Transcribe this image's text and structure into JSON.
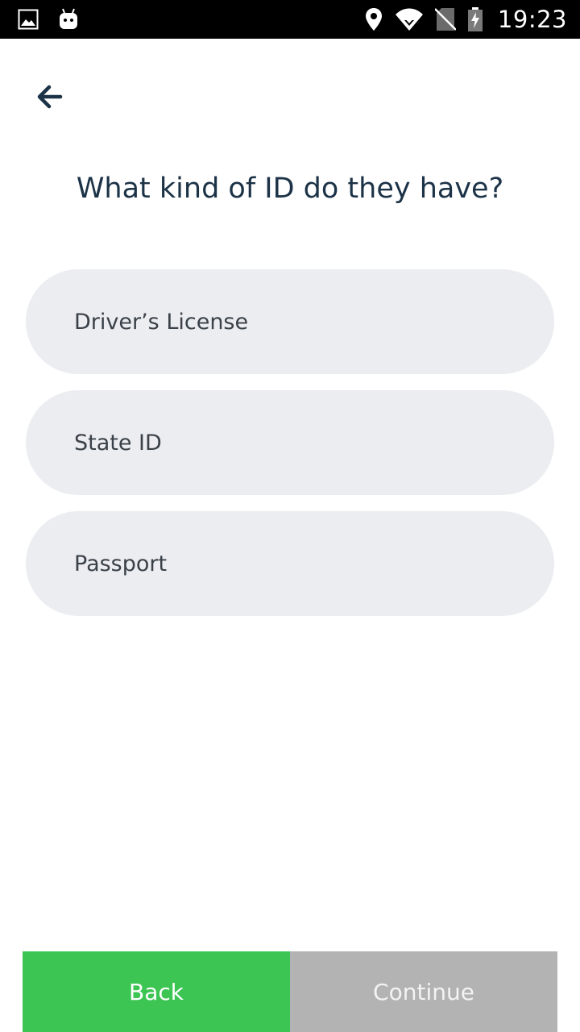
{
  "status_bar": {
    "time": "19:23",
    "left_icons": [
      "image-icon",
      "android-icon"
    ],
    "right_icons": [
      "location-icon",
      "wifi-icon",
      "no-sim-icon",
      "battery-charging-icon"
    ]
  },
  "header": {
    "back_icon": "arrow-left-icon"
  },
  "main": {
    "title": "What kind of ID do they have?",
    "options": [
      {
        "label": "Driver’s License"
      },
      {
        "label": "State ID"
      },
      {
        "label": "Passport"
      }
    ]
  },
  "footer": {
    "back_label": "Back",
    "continue_label": "Continue"
  },
  "colors": {
    "accent_green": "#3cc553",
    "disabled_gray": "#b3b3b3",
    "option_bg": "#ecedf1",
    "title_color": "#1c3347"
  }
}
